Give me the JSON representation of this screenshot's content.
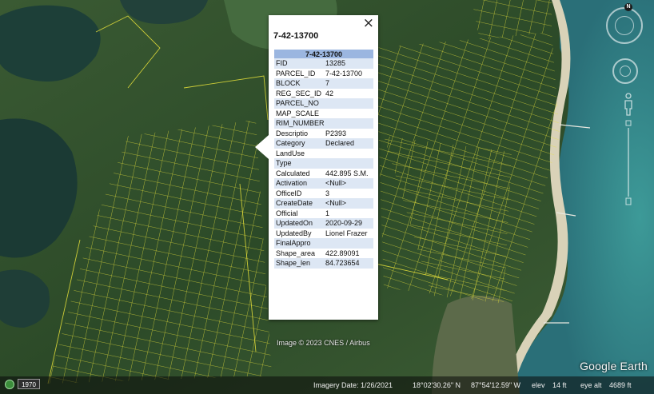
{
  "balloon": {
    "title": "7-42-13700",
    "close_icon": "×",
    "table_header": "7-42-13700",
    "rows": [
      {
        "key": "FID",
        "value": "13285"
      },
      {
        "key": "PARCEL_ID",
        "value": "7-42-13700"
      },
      {
        "key": "BLOCK",
        "value": "7"
      },
      {
        "key": "REG_SEC_ID",
        "value": "42"
      },
      {
        "key": "PARCEL_NO",
        "value": ""
      },
      {
        "key": "MAP_SCALE",
        "value": ""
      },
      {
        "key": "RIM_NUMBER",
        "value": ""
      },
      {
        "key": "Descriptio",
        "value": "P2393"
      },
      {
        "key": "Category",
        "value": "Declared"
      },
      {
        "key": "LandUse",
        "value": ""
      },
      {
        "key": "Type",
        "value": ""
      },
      {
        "key": "Calculated",
        "value": "442.895 S.M."
      },
      {
        "key": "Activation",
        "value": "<Null>"
      },
      {
        "key": "OfficeID",
        "value": "3"
      },
      {
        "key": "CreateDate",
        "value": "<Null>"
      },
      {
        "key": "Official",
        "value": "1"
      },
      {
        "key": "UpdatedOn",
        "value": "2020-09-29"
      },
      {
        "key": "UpdatedBy",
        "value": "Lionel Frazer"
      },
      {
        "key": "FinalAppro",
        "value": ""
      },
      {
        "key": "Shape_area",
        "value": "422.89091"
      },
      {
        "key": "Shape_len",
        "value": "84.723654"
      }
    ]
  },
  "map": {
    "image_credit": "Image © 2023 CNES / Airbus",
    "brand": "Google Earth",
    "parcel_line_color": "#e8e23a",
    "water_color": "#2f7f86"
  },
  "statusbar": {
    "history_year": "1970",
    "imagery_date": "Imagery Date: 1/26/2021",
    "latitude": "18°02'30.26\" N",
    "longitude": "87°54'12.59\" W",
    "elev_label": "elev",
    "elev_value": "14 ft",
    "eye_alt_label": "eye alt",
    "eye_alt_value": "4689 ft"
  },
  "nav": {
    "compass_north": "N",
    "icons": [
      "compass-icon",
      "look-joystick-icon",
      "street-view-pegman-icon",
      "zoom-slider-icon",
      "historical-imagery-icon"
    ]
  }
}
